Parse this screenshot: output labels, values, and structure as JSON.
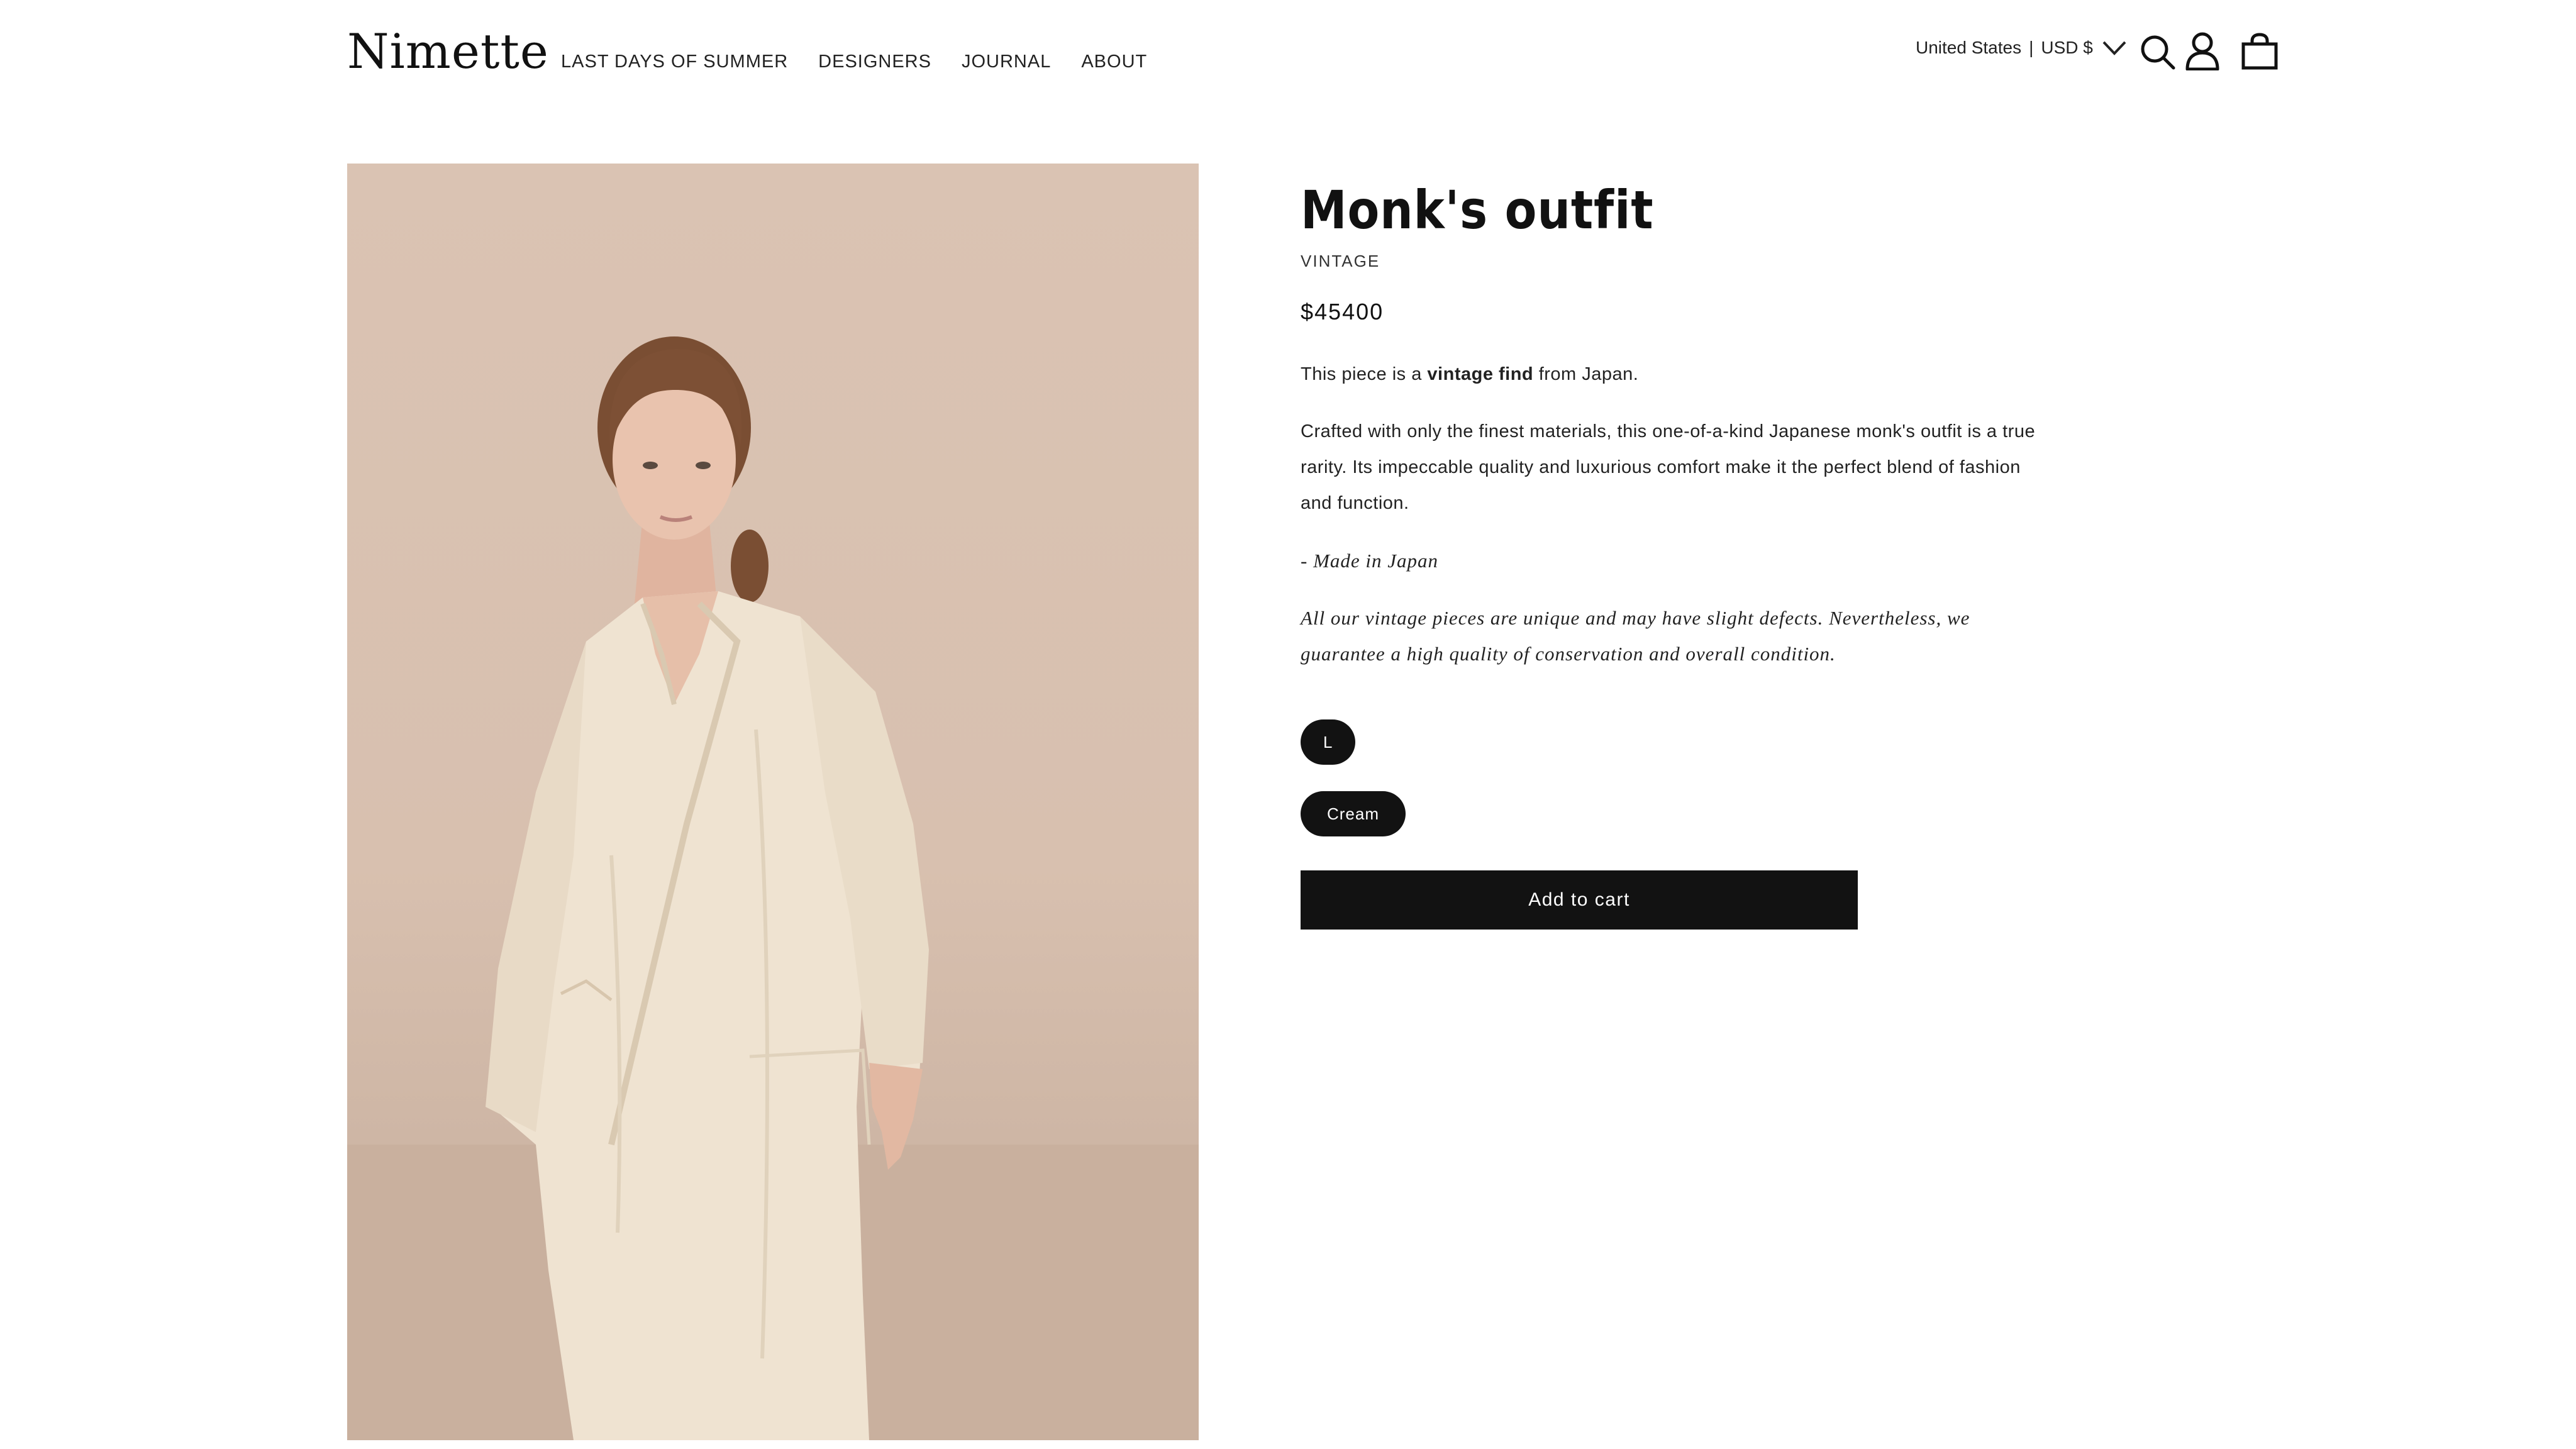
{
  "header": {
    "logo": "Nimette",
    "nav": [
      "LAST DAYS OF SUMMER",
      "DESIGNERS",
      "JOURNAL",
      "ABOUT"
    ],
    "locale": {
      "country": "United States",
      "separator": "|",
      "currency": "USD $"
    },
    "icons": [
      "chevron-down-icon",
      "search-icon",
      "account-icon",
      "cart-icon"
    ]
  },
  "product": {
    "title": "Monk's outfit",
    "vendor": "VINTAGE",
    "price": "$45400",
    "description": {
      "intro_prefix": "This piece is a",
      "intro_bold": "vintage find",
      "intro_suffix": "from Japan.",
      "body": "Crafted with only the finest materials, this one-of-a-kind Japanese monk's outfit is a true rarity. Its impeccable quality and luxurious comfort make it the perfect blend of fashion and function.",
      "origin": "- Made in Japan",
      "disclaimer": "All our vintage pieces are unique and may have slight defects. Nevertheless, we guarantee a high quality of conservation and overall condition."
    },
    "size": "L",
    "color": "Cream",
    "add_to_cart": "Add to cart"
  },
  "colors": {
    "primary": "#121212",
    "background": "#ffffff",
    "image_backdrop": "#d8c0af",
    "garment": "#efe3d1"
  }
}
